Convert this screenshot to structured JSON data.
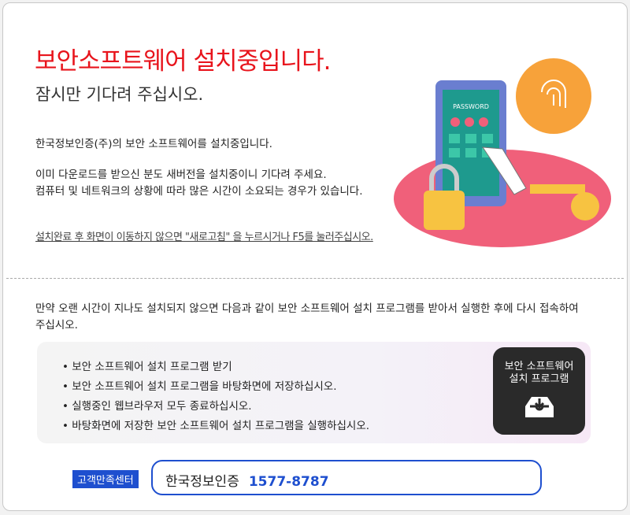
{
  "title": "보안소프트웨어 설치중입니다.",
  "subtitle": "잠시만 기다려 주십시오.",
  "para1": "한국정보인증(주)의 보안 소프트웨어를 설치중입니다.",
  "para2": "이미 다운로드를 받으신 분도 새버전을 설치중이니 기다려 주세요.",
  "para3": "컴퓨터 및 네트워크의 상황에 따라 많은 시간이 소요되는 경우가 있습니다.",
  "notice_link": "설치완료 후 화면이 이동하지 않으면 \"새로고침\" 을 누르시거나 F5를 눌러주십시오.",
  "fallback_text": "만약 오랜 시간이 지나도 설치되지 않으면 다음과 같이 보안 소프트웨어 설치 프로그램를 받아서 실행한 후에 다시 접속하여 주십시오.",
  "steps": [
    "보안 소프트웨어 설치 프로그램 받기",
    "보안 소프트웨어 설치 프로그램을 바탕화면에 저장하십시오.",
    "실행중인 웹브라우저 모두 종료하십시오.",
    "바탕화면에 저장한 보안 소프트웨어 설치 프로그램을 실행하십시오."
  ],
  "download_button": {
    "line1": "보안 소프트웨어",
    "line2": "설치 프로그램"
  },
  "illustration": {
    "keypad_label": "PASSWORD"
  },
  "support": {
    "label": "고객만족센터",
    "company": "한국정보인증",
    "phone": "1577-8787"
  }
}
